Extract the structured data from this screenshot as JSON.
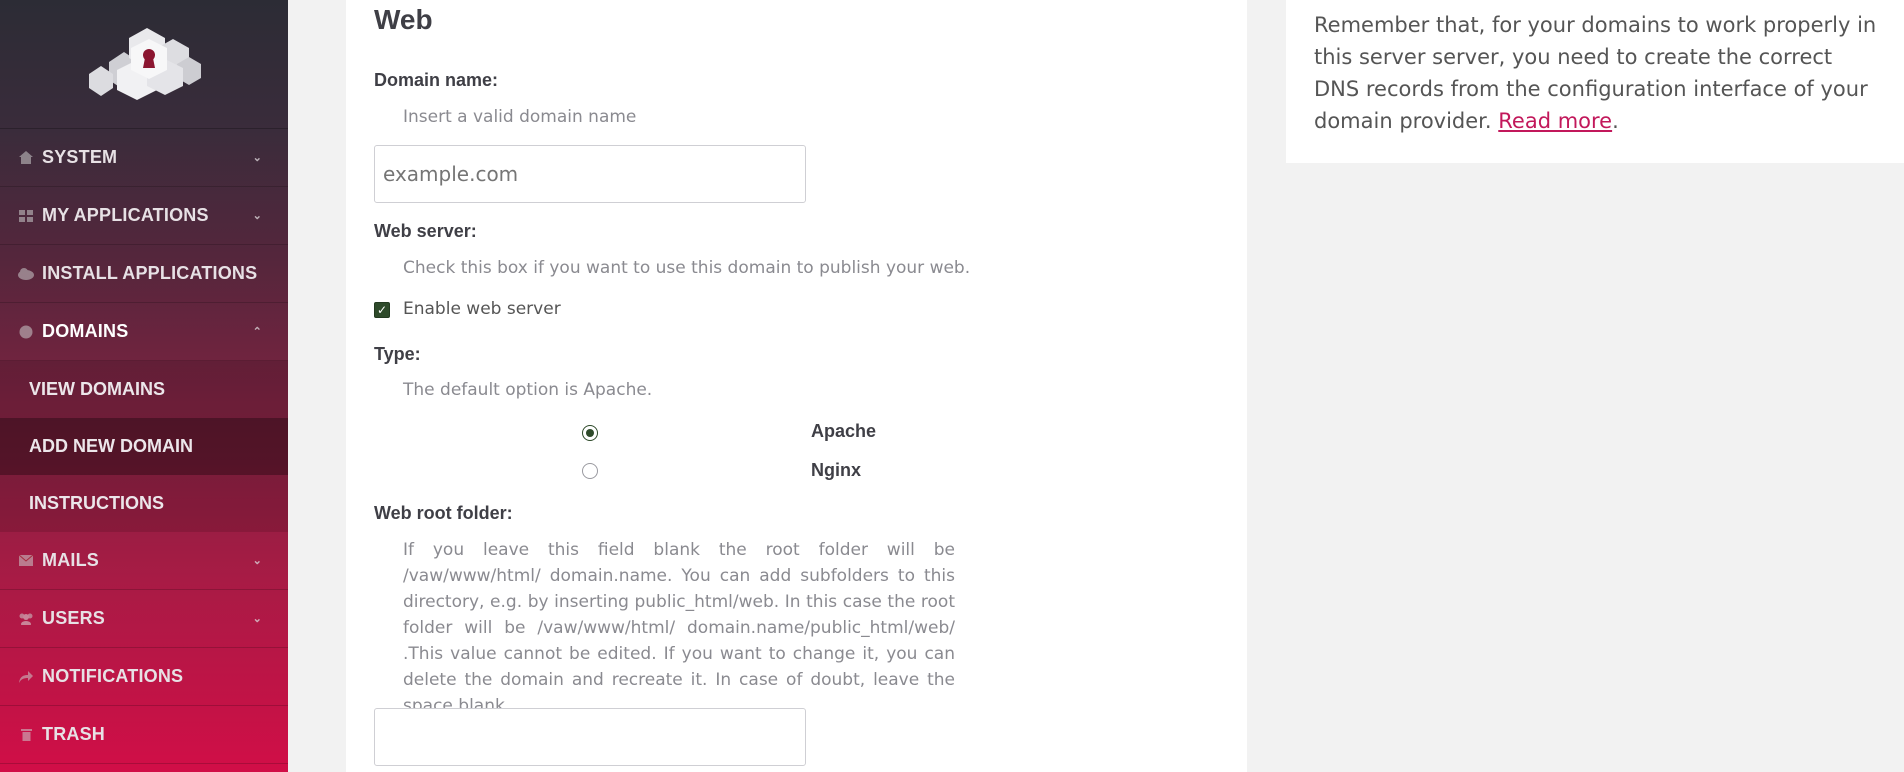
{
  "sidebar": {
    "items": [
      {
        "label": "SYSTEM",
        "icon": "home-icon"
      },
      {
        "label": "MY APPLICATIONS",
        "icon": "grid-icon"
      },
      {
        "label": "INSTALL APPLICATIONS",
        "icon": "cloud-download-icon"
      },
      {
        "label": "DOMAINS",
        "icon": "globe-icon"
      },
      {
        "label": "MAILS",
        "icon": "envelope-icon"
      },
      {
        "label": "USERS",
        "icon": "users-icon"
      },
      {
        "label": "NOTIFICATIONS",
        "icon": "share-icon"
      },
      {
        "label": "TRASH",
        "icon": "trash-icon"
      }
    ],
    "domains_submenu": [
      {
        "label": "VIEW DOMAINS"
      },
      {
        "label": "ADD NEW DOMAIN"
      },
      {
        "label": "INSTRUCTIONS"
      }
    ]
  },
  "form": {
    "section_title": "Web",
    "domain_name": {
      "label": "Domain name:",
      "help": "Insert a valid domain name",
      "placeholder": "example.com",
      "value": ""
    },
    "web_server": {
      "label": "Web server:",
      "help": "Check this box if you want to use this domain to publish your web.",
      "checkbox_label": "Enable web server",
      "checked": true
    },
    "type": {
      "label": "Type:",
      "help": "The default option is Apache.",
      "options": [
        {
          "label": "Apache",
          "selected": true
        },
        {
          "label": "Nginx",
          "selected": false
        }
      ]
    },
    "web_root": {
      "label": "Web root folder:",
      "help": "If you leave this field blank the root folder will be /vaw/www/html/ domain.name. You can add subfolders to this directory, e.g. by inserting public_html/web. In this case the root folder will be /vaw/www/html/ domain.name/public_html/web/ .This value cannot be edited. If you want to change it, you can delete the domain and recreate it. In case of doubt, leave the space blank.",
      "value": ""
    }
  },
  "info": {
    "text": "Remember that, for your domains to work properly in this server server, you need to create the correct DNS records from the configuration interface of your domain provider.",
    "link": "Read more",
    "after_link": "."
  },
  "colors": {
    "accent": "#c2185b",
    "sidebar_top": "#2c2c35",
    "sidebar_bottom": "#d10e47",
    "checkbox": "#2e4a2a"
  }
}
